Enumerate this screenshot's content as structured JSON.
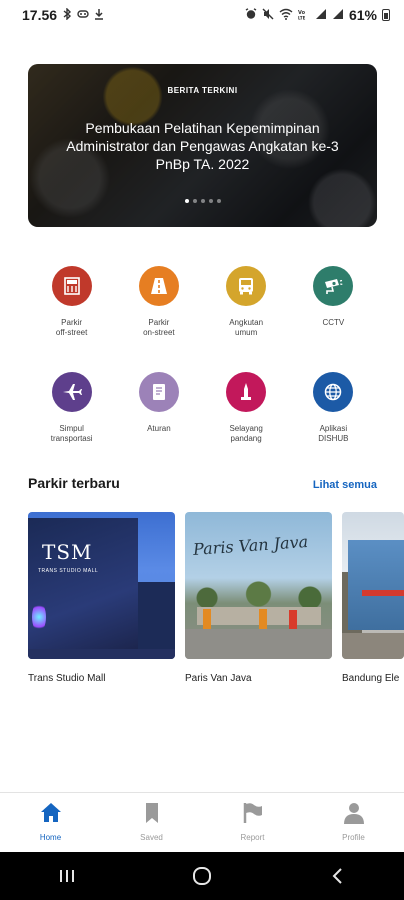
{
  "status_bar": {
    "time": "17.56",
    "left_icons": [
      "bluetooth-icon",
      "gamepad-icon",
      "download-icon"
    ],
    "right_icons": [
      "alarm-icon",
      "mute-icon",
      "wifi-icon",
      "volte-icon",
      "signal-icon",
      "signal-icon"
    ],
    "battery": "61%"
  },
  "banner": {
    "kicker": "BERITA TERKINI",
    "title": "Pembukaan Pelatihan Kepemimpinan Administrator dan Pengawas Angkatan ke-3 PnBp TA. 2022",
    "dots_total": 5,
    "active_dot": 0
  },
  "menu": [
    {
      "label": "Parkir\noff-street",
      "icon": "parking-building-icon",
      "color": "#c0392b"
    },
    {
      "label": "Parkir\non-street",
      "icon": "road-icon",
      "color": "#e67e22"
    },
    {
      "label": "Angkutan\numum",
      "icon": "bus-icon",
      "color": "#d4a52c"
    },
    {
      "label": "CCTV",
      "icon": "cctv-icon",
      "color": "#2e7d6b"
    },
    {
      "label": "Simpul\ntransportasi",
      "icon": "airplane-icon",
      "color": "#5e3f8c"
    },
    {
      "label": "Aturan",
      "icon": "book-icon",
      "color": "#9c82b8"
    },
    {
      "label": "Selayang\npandang",
      "icon": "monument-icon",
      "color": "#c2185b"
    },
    {
      "label": "Aplikasi\nDISHUB",
      "icon": "globe-icon",
      "color": "#1c5aa6"
    }
  ],
  "parking_section": {
    "title": "Parkir terbaru",
    "see_all": "Lihat semua",
    "items": [
      {
        "name": "Trans Studio Mall",
        "image_text": "TSM",
        "image_subtext": "TRANS STUDIO MALL"
      },
      {
        "name": "Paris Van Java",
        "image_text": "Paris Van Java"
      },
      {
        "name": "Bandung Ele"
      }
    ]
  },
  "bottom_nav": [
    {
      "label": "Home",
      "icon": "home-icon",
      "active": true
    },
    {
      "label": "Saved",
      "icon": "bookmark-icon",
      "active": false
    },
    {
      "label": "Report",
      "icon": "flag-icon",
      "active": false
    },
    {
      "label": "Profile",
      "icon": "person-icon",
      "active": false
    }
  ],
  "system_nav": [
    "recent-apps-icon",
    "home-circle-icon",
    "back-icon"
  ],
  "colors": {
    "accent": "#1565c0",
    "nav_inactive": "#9a9a9a"
  }
}
